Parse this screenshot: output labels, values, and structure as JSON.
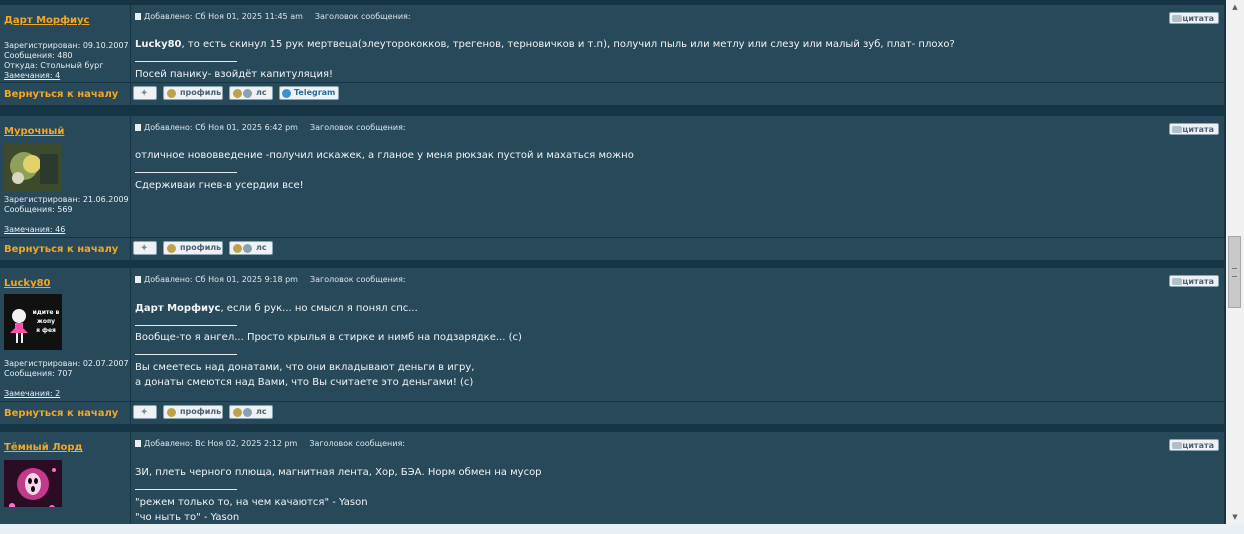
{
  "posts": [
    {
      "author": "Дарт Морфиус",
      "registered": "Зарегистрирован: 09.10.2007",
      "messages": "Сообщения: 480",
      "location": "Откуда: Стольный бург",
      "warnings": "Замечания: 4",
      "posted": "Добавлено: Сб Ноя 01, 2025 11:45 am",
      "subject": "Заголовок сообщения:",
      "quote_label": "цитата",
      "body_bold": "Lucky80",
      "body_rest": ", то есть скинул 15 рук мертвеца(элеуторококков, трегенов, терновичков и т.п), получил пыль или метлу или слезу или малый зуб, плат- плохо?",
      "signature": [
        "Посей панику- взойдёт капитуляция!"
      ],
      "back": "Вернуться к началу",
      "buttons": {
        "profile": "профиль",
        "pm": "лс",
        "telegram": "Telegram"
      }
    },
    {
      "author": "Мурочный",
      "registered": "Зарегистрирован: 21.06.2009",
      "messages": "Сообщения: 569",
      "warnings": "Замечания: 46",
      "posted": "Добавлено: Сб Ноя 01, 2025 6:42 pm",
      "subject": "Заголовок сообщения:",
      "quote_label": "цитата",
      "body": "отличное нововведение -получил искажек, а гланое у меня рюкзак пустой и махаться можно",
      "signature": [
        "Сдерживаи гнев-в усердии все!"
      ],
      "back": "Вернуться к началу",
      "buttons": {
        "profile": "профиль",
        "pm": "лс"
      }
    },
    {
      "author": "Lucky80",
      "avatar_text": [
        "идите в",
        "жопу",
        "я фея"
      ],
      "registered": "Зарегистрирован: 02.07.2007",
      "messages": "Сообщения: 707",
      "warnings": "Замечания: 2",
      "posted": "Добавлено: Сб Ноя 01, 2025 9:18 pm",
      "subject": "Заголовок сообщения:",
      "quote_label": "цитата",
      "body_bold": "Дарт Морфиус",
      "body_rest": ", если б рук... но смысл я понял спс...",
      "signature": [
        "Вообще-то я ангел... Просто крылья в стирке и нимб на подзарядке... (с)",
        "Вы смеетесь над донатами, что они вкладывают деньги в игру,",
        "а донаты смеются над Вами, что Вы считаете это деньгами! (с)"
      ],
      "back": "Вернуться к началу",
      "buttons": {
        "profile": "профиль",
        "pm": "лс"
      }
    },
    {
      "author": "Тёмный Лорд",
      "posted": "Добавлено: Вс Ноя 02, 2025 2:12 pm",
      "subject": "Заголовок сообщения:",
      "quote_label": "цитата",
      "body": "ЗИ, плеть черного плюща, магнитная лента, Хор, БЭА. Норм обмен на мусор",
      "signature": [
        "\"режем только то, на чем качаются\" - Yason",
        "\"чо ныть то\" - Yason"
      ]
    }
  ],
  "scrollbar": {
    "up": "▲",
    "down": "▼"
  }
}
